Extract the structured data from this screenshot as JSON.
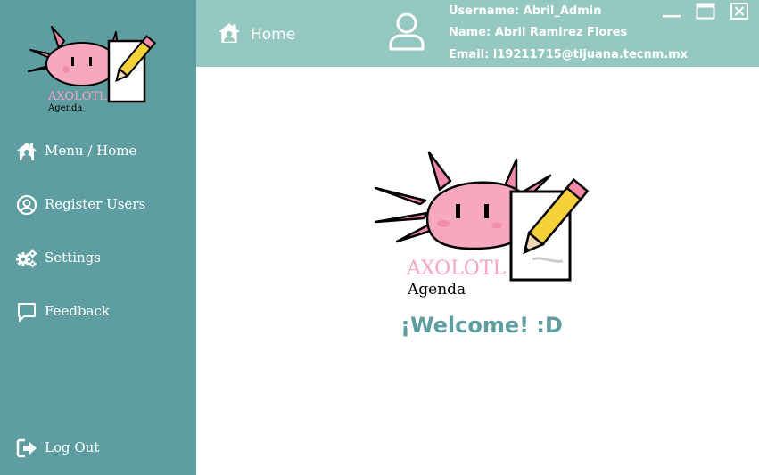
{
  "app": {
    "logo_title": "AXOLOTL",
    "logo_subtitle": "Agenda"
  },
  "sidebar": {
    "items": [
      {
        "label": "Menu / Home",
        "icon": "home-user-icon"
      },
      {
        "label": "Register Users",
        "icon": "user-circle-icon"
      },
      {
        "label": "Settings",
        "icon": "gears-icon"
      },
      {
        "label": "Feedback",
        "icon": "speech-bubble-icon"
      }
    ],
    "logout": {
      "label": "Log Out",
      "icon": "logout-icon"
    }
  },
  "header": {
    "breadcrumb": {
      "label": "Home",
      "icon": "home-user-icon"
    },
    "user": {
      "icon": "user-outline-icon",
      "username": "Username: Abril_Admin",
      "name": "Name: Abril  Ramirez Flores",
      "email": "Email: l19211715@tijuana.tecnm.mx"
    },
    "window_controls": [
      "minimize-icon",
      "maximize-icon",
      "close-icon"
    ]
  },
  "main": {
    "welcome": "¡Welcome! :D"
  },
  "colors": {
    "sidebar": "#5f9ea0",
    "topbar": "#95c8c1",
    "welcome_text": "#5f9ea0",
    "logo_pink": "#f49ab5",
    "logo_text_pink": "#f7a4c4"
  }
}
